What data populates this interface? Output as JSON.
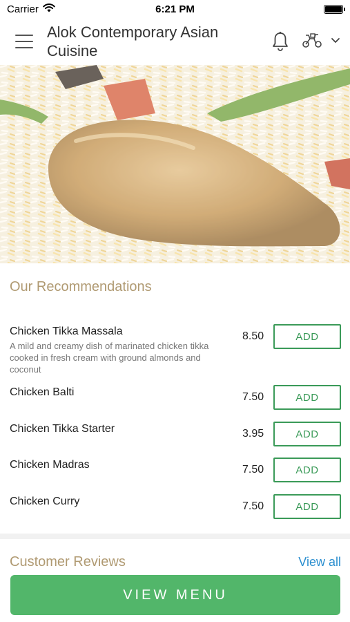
{
  "status_bar": {
    "carrier": "Carrier",
    "time": "6:21 PM"
  },
  "header": {
    "title": "Alok Contemporary Asian Cuisine",
    "icons": [
      "menu-icon",
      "bell-icon",
      "scooter-icon",
      "chevron-down-icon"
    ]
  },
  "hero": {
    "image": "chicken biryani"
  },
  "recommendations": {
    "title": "Our Recommendations",
    "add_label": "ADD",
    "items": [
      {
        "name": "Chicken Tikka Massala",
        "description": "A mild and creamy dish of marinated chicken tikka cooked in fresh cream with ground almonds and coconut",
        "price": "8.50"
      },
      {
        "name": "Chicken Balti",
        "description": "",
        "price": "7.50"
      },
      {
        "name": "Chicken Tikka Starter",
        "description": "",
        "price": "3.95"
      },
      {
        "name": "Chicken Madras",
        "description": "",
        "price": "7.50"
      },
      {
        "name": "Chicken Curry",
        "description": "",
        "price": "7.50"
      }
    ]
  },
  "reviews": {
    "title": "Customer Reviews",
    "view_all": "View all"
  },
  "footer": {
    "view_menu": "VIEW MENU"
  },
  "colors": {
    "accent_green": "#52b66a",
    "add_border": "#3a9a58",
    "section_title": "#b09a72",
    "link_blue": "#2a8ecf"
  }
}
